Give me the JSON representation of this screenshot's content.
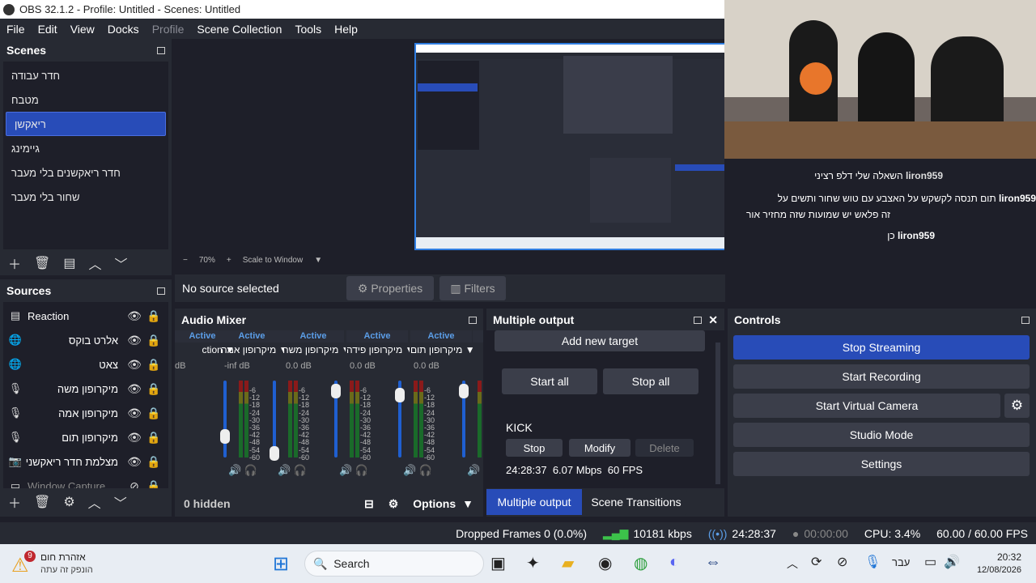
{
  "title": "OBS 32.1.2 - Profile: Untitled - Scenes: Untitled",
  "menu": [
    "File",
    "Edit",
    "View",
    "Docks",
    "Profile",
    "Scene Collection",
    "Tools",
    "Help"
  ],
  "scenes": {
    "title": "Scenes",
    "items": [
      "חדר עבודה",
      "מטבח",
      "ריאקשן",
      "גיימינג",
      "חדר ריאקשנים בלי מעבר",
      "שחור בלי מעבר"
    ],
    "selected": 2
  },
  "preview": {
    "zoom": "70%",
    "scale": "Scale to Window",
    "no_source": "No source selected",
    "properties": "Properties",
    "filters": "Filters"
  },
  "sources": {
    "title": "Sources",
    "items": [
      {
        "name": "Reaction",
        "icon": "layers-icon"
      },
      {
        "name": "אלרט בוקס",
        "icon": "globe-icon"
      },
      {
        "name": "צאט",
        "icon": "globe-icon"
      },
      {
        "name": "מיקרופון משה",
        "icon": "mic-icon"
      },
      {
        "name": "מיקרופון אמה",
        "icon": "mic-icon"
      },
      {
        "name": "מיקרופון תום",
        "icon": "mic-icon"
      },
      {
        "name": "מצלמת חדר ריאקשני",
        "icon": "camera-icon"
      },
      {
        "name": "Window Capture",
        "icon": "window-icon"
      }
    ]
  },
  "mixer": {
    "title": "Audio Mixer",
    "hidden": "0 hidden",
    "options": "Options",
    "channels": [
      {
        "name": "ction",
        "status": "Active",
        "db": "dB",
        "level": 0.7
      },
      {
        "name": "מיקרופון אמה",
        "status": "Active",
        "db": "-inf dB",
        "level": 0.95
      },
      {
        "name": "מיקרופון משה",
        "status": "Active",
        "db": "0.0 dB",
        "level": 0.05
      },
      {
        "name": "מיקרופון פידה",
        "status": "Active",
        "db": "0.0 dB",
        "level": 0.1
      },
      {
        "name": "מיקרופון תום",
        "status": "Active",
        "db": "0.0 dB",
        "level": 0.05
      },
      {
        "name": "מיקרופון",
        "status": "Active",
        "db": "",
        "level": 0.05
      }
    ],
    "scale": [
      "-6",
      "-12",
      "-18",
      "-24",
      "-30",
      "-36",
      "-42",
      "-48",
      "-54",
      "-60"
    ]
  },
  "multi": {
    "title": "Multiple output",
    "add": "Add new target",
    "start_all": "Start all",
    "stop_all": "Stop all",
    "target": "KICK",
    "stop": "Stop",
    "modify": "Modify",
    "delete": "Delete",
    "stats": "24:28:37  6.07 Mbps  60 FPS",
    "tab1": "Multiple output",
    "tab2": "Scene Transitions"
  },
  "controls": {
    "title": "Controls",
    "stop_streaming": "Stop Streaming",
    "start_recording": "Start Recording",
    "start_virtual": "Start Virtual Camera",
    "studio": "Studio Mode",
    "settings": "Settings"
  },
  "status": {
    "dropped": "Dropped Frames 0 (0.0%)",
    "kbps": "10181 kbps",
    "live_time": "24:28:37",
    "rec_time": "00:00:00",
    "cpu": "CPU: 3.4%",
    "fps": "60.00 / 60.00 FPS"
  },
  "chat": [
    {
      "user": "liron959",
      "msg": "השאלה שלי דלפ רציני"
    },
    {
      "user": "liron959",
      "msg": "תום תנסה לקשקש על האצבע עם טוש שחור ותשים על"
    },
    {
      "user": "",
      "msg": "זה פלאש יש שמועות שזה מחזיר אור"
    },
    {
      "user": "liron959",
      "msg": "כן"
    }
  ],
  "taskbar": {
    "weather_title": "אזהרת חום",
    "weather_sub": "הונפק זה עתה",
    "badge": "9",
    "search": "Search",
    "lang": "עבר",
    "time": "20:32",
    "date": "12/08/2026"
  },
  "colors": {
    "accent": "#284cb8",
    "panel": "#272a33",
    "bg": "#1e1f29"
  }
}
